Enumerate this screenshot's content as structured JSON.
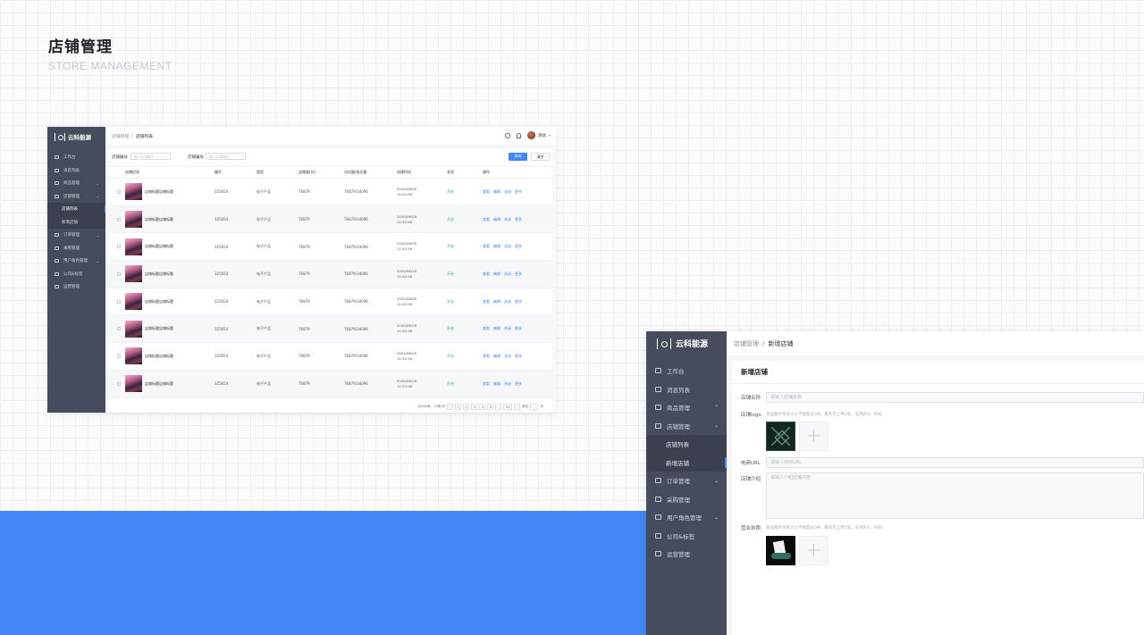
{
  "heading": {
    "title": "店铺管理",
    "subtitle": "STORE MANAGEMENT"
  },
  "app": {
    "logo_text": "云科能源"
  },
  "nav": {
    "workbench": "工作台",
    "messages": "消息列表",
    "products": "商品管理",
    "stores": "店铺管理",
    "store_list": "店铺列表",
    "add_store": "新增店铺",
    "orders": "订单管理",
    "purchase": "采购管理",
    "user_roles": "用户角色管理",
    "company_tags": "公司&标签",
    "operations": "运营管理"
  },
  "list_page": {
    "breadcrumb_root": "店铺管理",
    "breadcrumb_sep": "/",
    "breadcrumb_current": "店铺列表",
    "user_name": "测试",
    "filter": {
      "store_no_label": "店铺编号",
      "store_no_placeholder": "输入店铺编号",
      "store_name_label": "店铺编号",
      "store_name_placeholder": "输入店铺编号",
      "query_button": "查询",
      "clear_button": "清空"
    },
    "table": {
      "headers": [
        "店铺信息",
        "编号",
        "类型",
        "店铺量(台)",
        "访问量/成交量",
        "创建时间",
        "状态",
        "操作"
      ],
      "rows": [
        {
          "name": "店铺标题店铺标题",
          "no": "325654",
          "type": "电子产品",
          "total": "76879",
          "visit": "76879/34096",
          "date": "2020/06/28",
          "time": "11:52:56",
          "status": "开启",
          "ops": [
            "查看",
            "编辑",
            "关闭",
            "更多"
          ]
        },
        {
          "name": "店铺标题店铺标题",
          "no": "325654",
          "type": "电子产品",
          "total": "76879",
          "visit": "76879/34096",
          "date": "2020/06/28",
          "time": "11:52:56",
          "status": "开启",
          "ops": [
            "查看",
            "编辑",
            "关闭",
            "更多"
          ]
        },
        {
          "name": "店铺标题店铺标题",
          "no": "325654",
          "type": "电子产品",
          "total": "76879",
          "visit": "76879/34096",
          "date": "2020/06/28",
          "time": "11:52:56",
          "status": "开启",
          "ops": [
            "查看",
            "编辑",
            "关闭",
            "更多"
          ]
        },
        {
          "name": "店铺标题店铺标题",
          "no": "325654",
          "type": "电子产品",
          "total": "76879",
          "visit": "76879/34096",
          "date": "2020/06/28",
          "time": "11:52:56",
          "status": "开启",
          "ops": [
            "查看",
            "编辑",
            "关闭",
            "更多"
          ]
        },
        {
          "name": "店铺标题店铺标题",
          "no": "325654",
          "type": "电子产品",
          "total": "76879",
          "visit": "76879/34096",
          "date": "2020/06/28",
          "time": "11:52:56",
          "status": "开启",
          "ops": [
            "查看",
            "编辑",
            "关闭",
            "更多"
          ]
        },
        {
          "name": "店铺标题店铺标题",
          "no": "325654",
          "type": "电子产品",
          "total": "76879",
          "visit": "76879/34096",
          "date": "2020/06/28",
          "time": "11:52:56",
          "status": "开启",
          "ops": [
            "查看",
            "编辑",
            "关闭",
            "更多"
          ]
        },
        {
          "name": "店铺标题店铺标题",
          "no": "325654",
          "type": "电子产品",
          "total": "76879",
          "visit": "76879/34096",
          "date": "2020/06/28",
          "time": "11:52:56",
          "status": "开启",
          "ops": [
            "查看",
            "编辑",
            "关闭",
            "更多"
          ]
        },
        {
          "name": "店铺标题店铺标题",
          "no": "325654",
          "type": "电子产品",
          "total": "76879",
          "visit": "76879/34096",
          "date": "2020/06/28",
          "time": "11:52:56",
          "status": "开启",
          "ops": [
            "查看",
            "编辑",
            "关闭",
            "更多"
          ]
        }
      ]
    },
    "pagination": {
      "summary": "共400条，10条/页",
      "prev": "‹",
      "pages": [
        "1",
        "2",
        "3",
        "4",
        "5",
        "...",
        "50"
      ],
      "next": "›",
      "goto_label": "前往",
      "page_unit": "页"
    }
  },
  "add_page": {
    "breadcrumb_root": "店铺管理",
    "breadcrumb_sep": "/",
    "breadcrumb_current": "新增店铺",
    "title": "新增店铺",
    "store_name_label": "店铺名称",
    "store_name_placeholder": "请输入店铺名称",
    "logo_label": "店铺logo",
    "logo_hint": "商品图片单张大小不能超过3M，最多可上传5张，支持JPG、PNG",
    "url_label": "电商URL",
    "url_placeholder": "请输入电商URL",
    "intro_label": "店铺介绍",
    "intro_placeholder": "请输入介绍店铺内容",
    "license_label": "营业执照",
    "license_hint": "商品图片单张大小不能超过3M，最多可上传5张，支持JPG、PNG",
    "add_icon": "+"
  },
  "colors": {
    "primary": "#4287f5",
    "sidebar": "#464b5e",
    "status_green": "#2bb673"
  }
}
